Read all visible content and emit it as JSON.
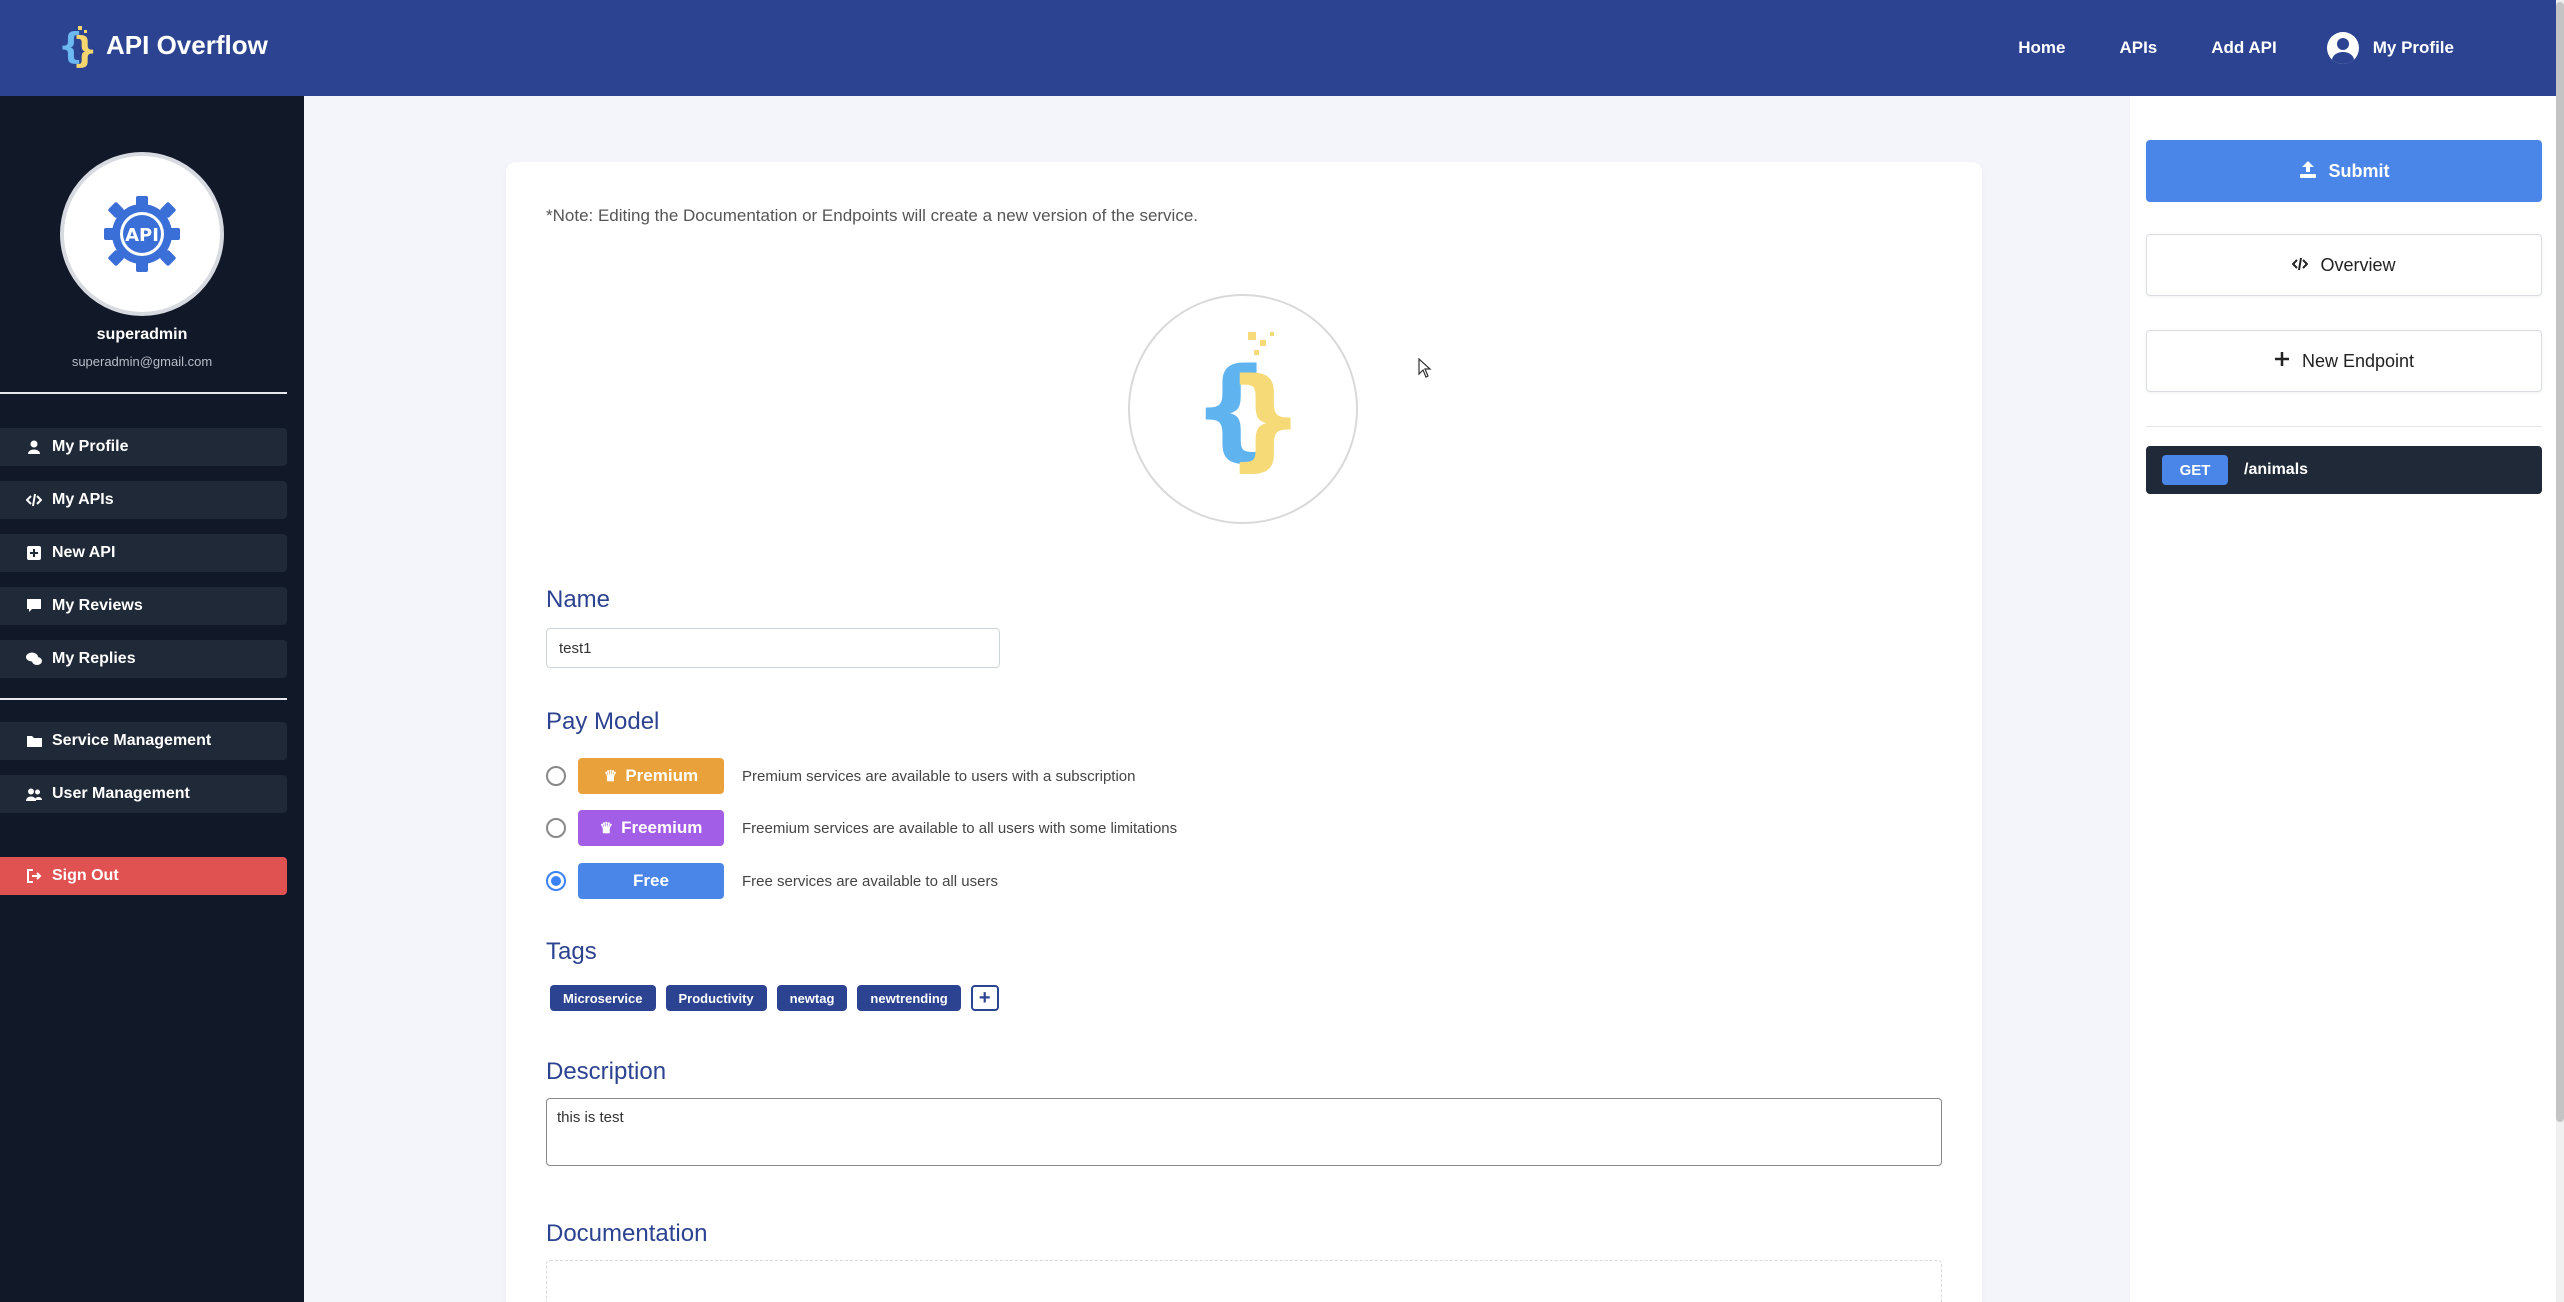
{
  "header": {
    "brand": "API Overflow",
    "nav": {
      "home": "Home",
      "apis": "APIs",
      "add_api": "Add API",
      "profile": "My Profile"
    }
  },
  "sidebar": {
    "avatar_text": "API",
    "username": "superadmin",
    "email": "superadmin@gmail.com",
    "items": [
      {
        "label": "My Profile",
        "icon": "user-icon"
      },
      {
        "label": "My APIs",
        "icon": "code-icon"
      },
      {
        "label": "New API",
        "icon": "plus-square-icon"
      },
      {
        "label": "My Reviews",
        "icon": "comment-icon"
      },
      {
        "label": "My Replies",
        "icon": "comments-icon"
      }
    ],
    "admin_items": [
      {
        "label": "Service Management",
        "icon": "folder-icon"
      },
      {
        "label": "User Management",
        "icon": "users-icon"
      }
    ],
    "signout": "Sign Out"
  },
  "form": {
    "note": "*Note: Editing the Documentation or Endpoints will create a new version of the service.",
    "name_label": "Name",
    "name_value": "test1",
    "pay_model_label": "Pay Model",
    "pay_options": [
      {
        "label": "Premium",
        "desc": "Premium services are available to users with a subscription",
        "color": "#e9a23b",
        "selected": false
      },
      {
        "label": "Freemium",
        "desc": "Freemium services are available to all users with some limitations",
        "color": "#a35ee8",
        "selected": false
      },
      {
        "label": "Free",
        "desc": "Free services are available to all users",
        "color": "#4a86e8",
        "selected": true
      }
    ],
    "tags_label": "Tags",
    "tags": [
      "Microservice",
      "Productivity",
      "newtag",
      "newtrending"
    ],
    "description_label": "Description",
    "description_value": "this is test",
    "documentation_label": "Documentation"
  },
  "right_panel": {
    "submit": "Submit",
    "overview": "Overview",
    "new_endpoint": "New Endpoint",
    "endpoints": [
      {
        "method": "GET",
        "path": "/animals"
      }
    ]
  },
  "colors": {
    "navbar": "#2c4391",
    "sidebar": "#111827",
    "accent": "#4a86e8",
    "signout": "#e05252"
  }
}
